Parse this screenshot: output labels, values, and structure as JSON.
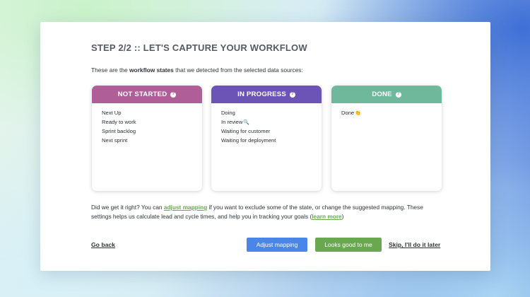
{
  "header": {
    "title": "STEP 2/2 :: LET'S CAPTURE YOUR WORKFLOW",
    "intro_prefix": "These are the ",
    "intro_bold": "workflow states",
    "intro_suffix": " that we detected from the selected data sources:"
  },
  "columns": [
    {
      "title": "NOT STARTED",
      "color": "#b05e98",
      "icon": "help-circle-icon",
      "items": [
        "Next Up",
        "Ready to work",
        "Sprint backlog",
        "Next sprint"
      ]
    },
    {
      "title": "IN PROGRESS",
      "color": "#6b54b5",
      "icon": "help-circle-icon",
      "items": [
        "Doing",
        "In review",
        "Waiting for customer",
        "Waiting for deployment"
      ],
      "item_icons": {
        "In review": "🔍"
      }
    },
    {
      "title": "DONE",
      "color": "#6fb89b",
      "icon": "help-circle-icon",
      "items": [
        "Done"
      ],
      "item_icons": {
        "Done": "👏"
      }
    }
  ],
  "description": {
    "part1": "Did we get it right? You can ",
    "link1": "adjust mapping",
    "part2": " if you want to exclude some of the state, or change the suggested mapping. These settings helps us calculate lead and cycle times, and help you in tracking your goals (",
    "link2": "learn more",
    "part3": ")"
  },
  "actions": {
    "go_back": "Go back",
    "adjust_mapping": "Adjust mapping",
    "looks_good": "Looks good to me",
    "skip": "Skip, I'll do it later"
  },
  "colors": {
    "adjust_button": "#4a86e8",
    "looks_good_button": "#6aa84f",
    "link": "#6aa84f"
  }
}
